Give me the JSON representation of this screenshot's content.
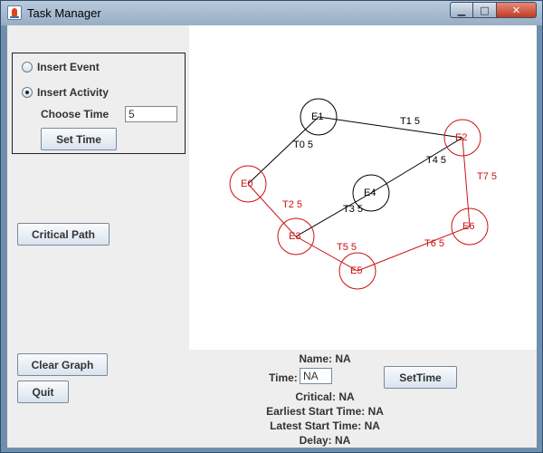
{
  "window": {
    "title": "Task Manager",
    "controls": {
      "minimize": "▁",
      "maximize": "□",
      "close": "✕"
    }
  },
  "left_panel": {
    "radio_insert_event": {
      "label": "Insert Event",
      "checked": false
    },
    "radio_insert_activity": {
      "label": "Insert Activity",
      "checked": true
    },
    "choose_time_label": "Choose Time",
    "choose_time_value": "5",
    "set_time_button": "Set Time",
    "critical_path_button": "Critical Path",
    "clear_graph_button": "Clear Graph",
    "quit_button": "Quit"
  },
  "graph": {
    "colors": {
      "normal": "#000000",
      "critical": "#cc1111"
    },
    "nodes": [
      {
        "id": "E0",
        "label": "E0",
        "critical": true
      },
      {
        "id": "E1",
        "label": "E1",
        "critical": false
      },
      {
        "id": "E2",
        "label": "E2",
        "critical": true
      },
      {
        "id": "E3",
        "label": "E3",
        "critical": true
      },
      {
        "id": "E4",
        "label": "E4",
        "critical": false
      },
      {
        "id": "E5",
        "label": "E5",
        "critical": true
      },
      {
        "id": "E6",
        "label": "E6",
        "critical": true
      }
    ],
    "edges": [
      {
        "from": "E0",
        "to": "E1",
        "label": "T0 5",
        "critical": false
      },
      {
        "from": "E1",
        "to": "E2",
        "label": "T1 5",
        "critical": false
      },
      {
        "from": "E0",
        "to": "E3",
        "label": "T2 5",
        "critical": true
      },
      {
        "from": "E3",
        "to": "E4",
        "label": "T3 5",
        "critical": false
      },
      {
        "from": "E4",
        "to": "E2",
        "label": "T4 5",
        "critical": false
      },
      {
        "from": "E3",
        "to": "E5",
        "label": "T5 5",
        "critical": true
      },
      {
        "from": "E5",
        "to": "E6",
        "label": "T6 5",
        "critical": true
      },
      {
        "from": "E2",
        "to": "E6",
        "label": "T7 5",
        "critical": true
      }
    ]
  },
  "details": {
    "name_label": "Name:",
    "name_value": "NA",
    "time_label": "Time:",
    "time_value": "NA",
    "set_time_button": "SetTime",
    "critical_label": "Critical:",
    "critical_value": "NA",
    "earliest_label": "Earliest Start Time:",
    "earliest_value": "NA",
    "latest_label": "Latest Start Time:",
    "latest_value": "NA",
    "delay_label": "Delay:",
    "delay_value": "NA"
  }
}
